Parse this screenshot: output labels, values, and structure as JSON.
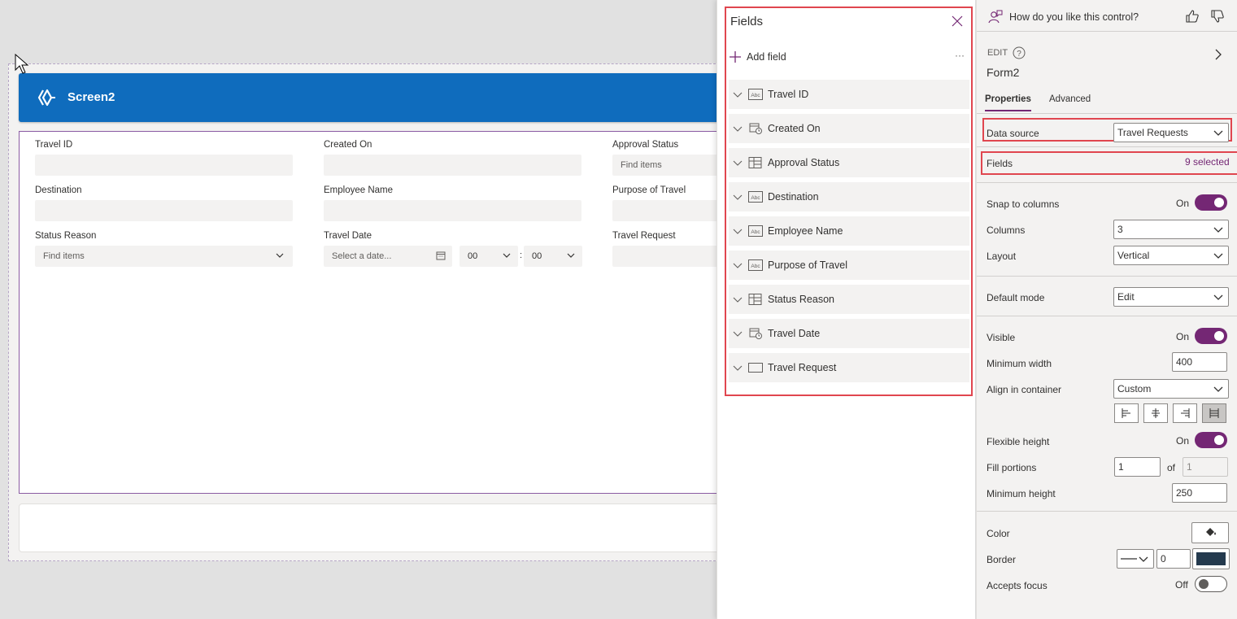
{
  "canvas": {
    "screen_title": "Screen2",
    "form_fields": [
      {
        "label": "Travel ID",
        "placeholder": ""
      },
      {
        "label": "Created On",
        "placeholder": ""
      },
      {
        "label": "Approval Status",
        "placeholder": "Find items"
      },
      {
        "label": "Destination",
        "placeholder": ""
      },
      {
        "label": "Employee Name",
        "placeholder": ""
      },
      {
        "label": "Purpose of Travel",
        "placeholder": ""
      },
      {
        "label": "Status Reason",
        "placeholder": "Find items"
      },
      {
        "label": "Travel Date",
        "placeholder": "Select a date..."
      },
      {
        "label": "Travel Request",
        "placeholder": ""
      }
    ],
    "hour": "00",
    "minute": "00",
    "time_sep": ":"
  },
  "fields_panel": {
    "title": "Fields",
    "add_field": "Add field",
    "more": "···",
    "items": [
      {
        "label": "Travel ID",
        "icon": "text-field-icon"
      },
      {
        "label": "Created On",
        "icon": "datetime-field-icon"
      },
      {
        "label": "Approval Status",
        "icon": "choice-field-icon"
      },
      {
        "label": "Destination",
        "icon": "text-field-icon"
      },
      {
        "label": "Employee Name",
        "icon": "text-field-icon"
      },
      {
        "label": "Purpose of Travel",
        "icon": "text-field-icon"
      },
      {
        "label": "Status Reason",
        "icon": "choice-field-icon"
      },
      {
        "label": "Travel Date",
        "icon": "datetime-field-icon"
      },
      {
        "label": "Travel Request",
        "icon": "rect-field-icon"
      }
    ]
  },
  "properties": {
    "feedback_text": "How do you like this control?",
    "edit_label": "EDIT",
    "form_name": "Form2",
    "tabs": [
      "Properties",
      "Advanced"
    ],
    "data_source_label": "Data source",
    "data_source_value": "Travel Requests",
    "fields_label": "Fields",
    "fields_value": "9 selected",
    "snap_label": "Snap to columns",
    "snap_state": "On",
    "columns_label": "Columns",
    "columns_value": "3",
    "layout_label": "Layout",
    "layout_value": "Vertical",
    "default_mode_label": "Default mode",
    "default_mode_value": "Edit",
    "visible_label": "Visible",
    "visible_state": "On",
    "min_width_label": "Minimum width",
    "min_width_value": "400",
    "align_label": "Align in container",
    "align_value": "Custom",
    "flex_height_label": "Flexible height",
    "flex_height_state": "On",
    "fill_portions_label": "Fill portions",
    "fill_portions_value": "1",
    "fill_of": "of",
    "fill_total": "1",
    "min_height_label": "Minimum height",
    "min_height_value": "250",
    "color_label": "Color",
    "border_label": "Border",
    "border_width": "0",
    "border_color": "#243a4e",
    "accepts_focus_label": "Accepts focus",
    "accepts_focus_state": "Off"
  },
  "colors": {
    "accent": "#742774",
    "header_blue": "#0f6cbd",
    "highlight_red": "#e0464f"
  }
}
